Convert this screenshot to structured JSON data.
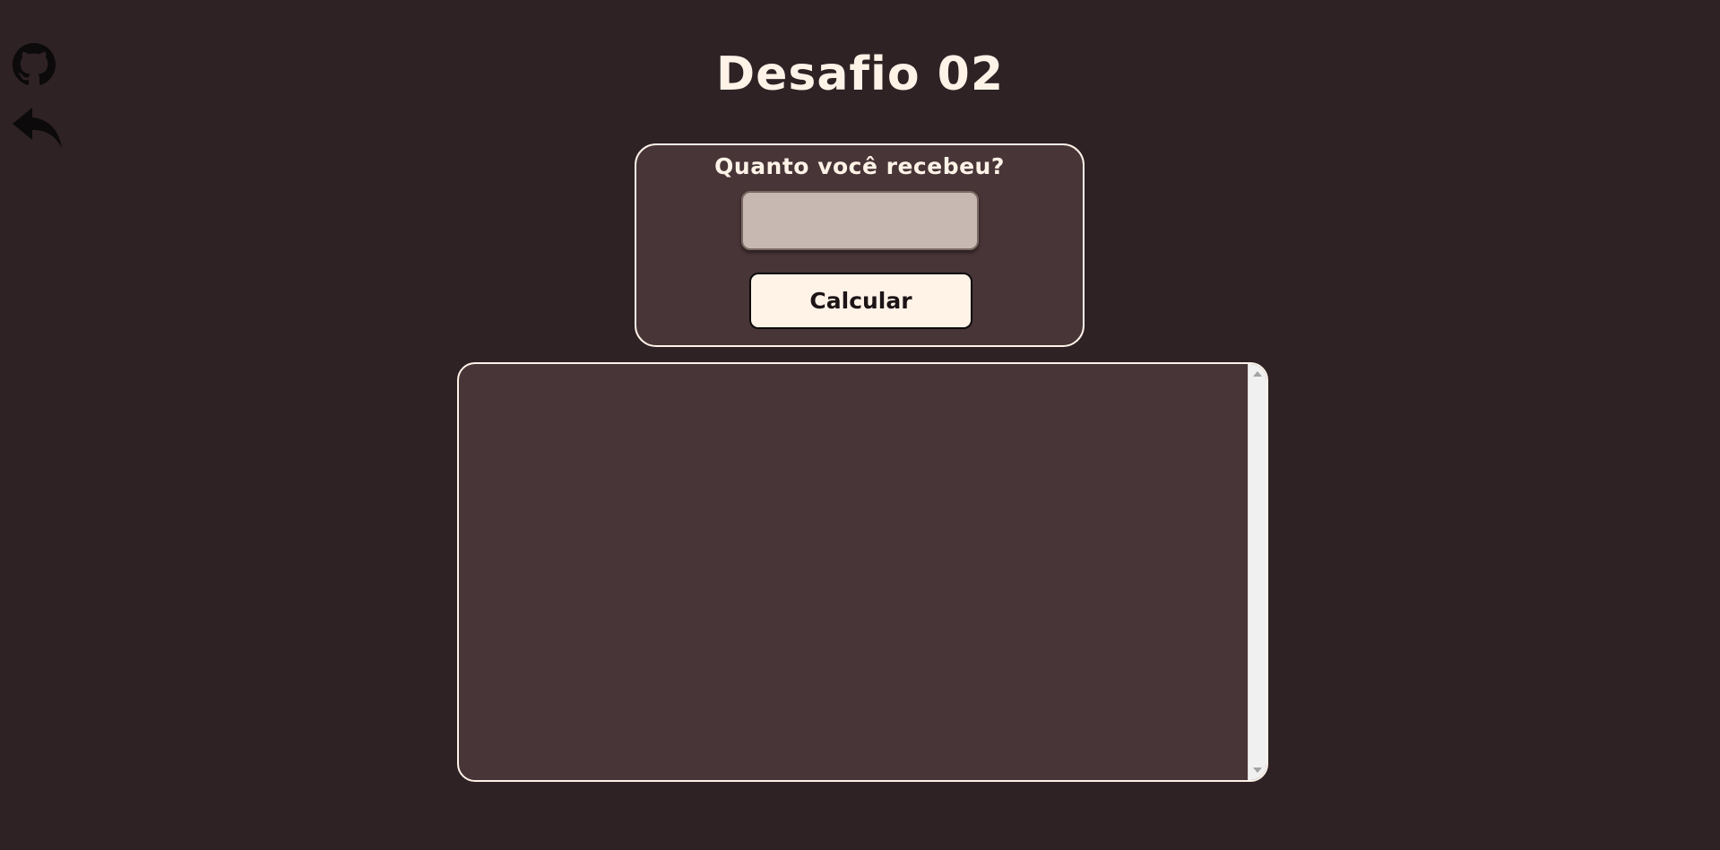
{
  "sidebar": {
    "github_icon": "github-icon",
    "back_icon": "reply-arrow-icon"
  },
  "page": {
    "title": "Desafio 02"
  },
  "form": {
    "label": "Quanto você recebeu?",
    "input_value": "",
    "input_placeholder": "",
    "button_label": "Calcular"
  },
  "result": {
    "content": ""
  },
  "colors": {
    "background": "#2e2225",
    "card": "#483537",
    "text": "#fff3e8",
    "input": "#c7b9b2",
    "icon": "#0c0a0b"
  }
}
